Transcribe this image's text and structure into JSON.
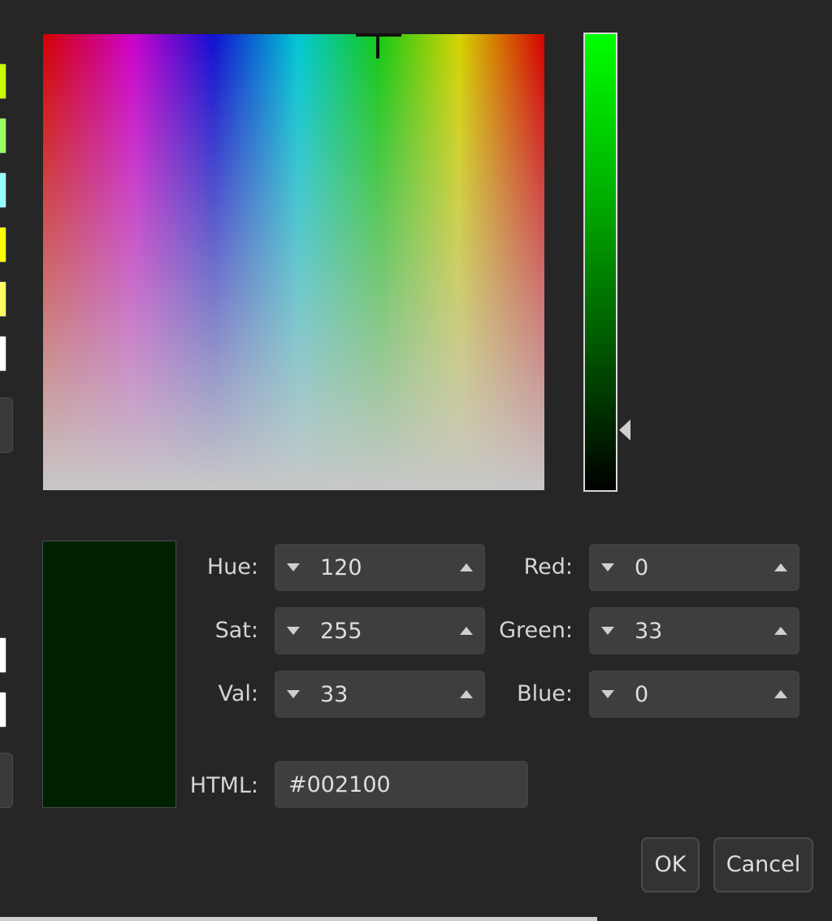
{
  "colors": {
    "current": "#002100",
    "swatches": [
      "#c8ff00",
      "#96ff64",
      "#96ffff",
      "#ffff00",
      "#ffff64",
      "#ffffff",
      "#ffffff",
      "#ffffff"
    ]
  },
  "fields": {
    "hue": {
      "label": "Hue:",
      "value": "120"
    },
    "sat": {
      "label": "Sat:",
      "value": "255"
    },
    "val": {
      "label": "Val:",
      "value": "33"
    },
    "red": {
      "label": "Red:",
      "value": "0"
    },
    "green": {
      "label": "Green:",
      "value": "33"
    },
    "blue": {
      "label": "Blue:",
      "value": "0"
    },
    "html": {
      "label": "HTML:",
      "value": "#002100"
    }
  },
  "buttons": {
    "ok": "OK",
    "cancel": "Cancel"
  },
  "icons": {
    "spin_down": "triangle-down-icon",
    "spin_up": "triangle-up-icon",
    "crosshair": "crosshair-icon",
    "value_pointer": "triangle-left-icon"
  }
}
